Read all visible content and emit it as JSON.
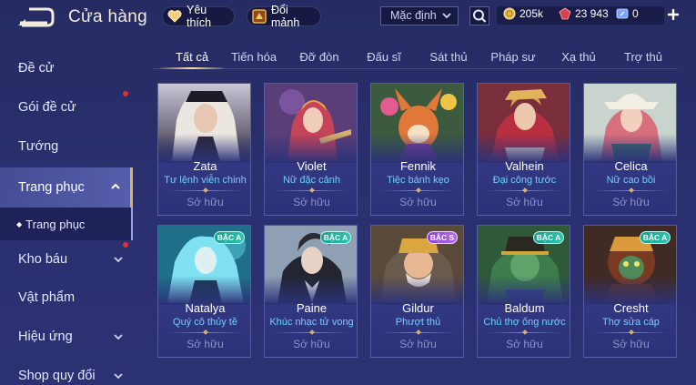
{
  "header": {
    "title": "Cửa hàng",
    "favorites_label": "Yêu thích",
    "fragments_label": "Đổi mảnh",
    "sort_value": "Mặc định",
    "gold": "205k",
    "gems": "23 943",
    "vouchers": "0"
  },
  "sidebar": {
    "items": [
      {
        "label": "Đề cử"
      },
      {
        "label": "Gói đề cử"
      },
      {
        "label": "Tướng"
      },
      {
        "label": "Trang phục"
      },
      {
        "label": "Trang phục"
      },
      {
        "label": "Kho báu"
      },
      {
        "label": "Vật phẩm"
      },
      {
        "label": "Hiệu ứng"
      },
      {
        "label": "Shop quy đổi"
      }
    ]
  },
  "tabs": [
    "Tất cả",
    "Tiến hóa",
    "Đỡ đòn",
    "Đấu sĩ",
    "Sát thủ",
    "Pháp sư",
    "Xạ thủ",
    "Trợ thủ"
  ],
  "cards": [
    {
      "name": "Zata",
      "skin": "Tư lệnh viễn chinh",
      "status": "Sở hữu",
      "badge": ""
    },
    {
      "name": "Violet",
      "skin": "Nữ đặc cảnh",
      "status": "Sở hữu",
      "badge": ""
    },
    {
      "name": "Fennik",
      "skin": "Tiệc bánh kẹo",
      "status": "Sở hữu",
      "badge": ""
    },
    {
      "name": "Valhein",
      "skin": "Đại công tước",
      "status": "Sở hữu",
      "badge": ""
    },
    {
      "name": "Celica",
      "skin": "Nữ cao bồi",
      "status": "Sở hữu",
      "badge": ""
    },
    {
      "name": "Natalya",
      "skin": "Quý cô thủy tề",
      "status": "Sở hữu",
      "badge": "BẬC A"
    },
    {
      "name": "Paine",
      "skin": "Khúc nhạc tử vong",
      "status": "Sở hữu",
      "badge": "BẬC A"
    },
    {
      "name": "Gildur",
      "skin": "Phượt thủ",
      "status": "Sở hữu",
      "badge": "BẬC S"
    },
    {
      "name": "Baldum",
      "skin": "Chủ thợ ống nước",
      "status": "Sở hữu",
      "badge": "BẬC A"
    },
    {
      "name": "Cresht",
      "skin": "Thợ sửa cáp",
      "status": "Sở hữu",
      "badge": "BẬC A"
    }
  ],
  "colors": {
    "background": "#2a2f6e",
    "accent_gold": "#d9b45a",
    "skin_text": "#6fd0ff",
    "owned_text": "#8b92c8",
    "badge_a": "#2bc4b0",
    "badge_s": "#b46af0",
    "notification_dot": "#e0302f"
  },
  "icons": {
    "back": "back-arrow-icon",
    "favorites": "heart-icon",
    "fragments": "fragment-icon",
    "search": "search-icon",
    "gold": "gold-coin-icon",
    "gems": "ruby-icon",
    "vouchers": "voucher-icon",
    "add": "plus-icon"
  }
}
